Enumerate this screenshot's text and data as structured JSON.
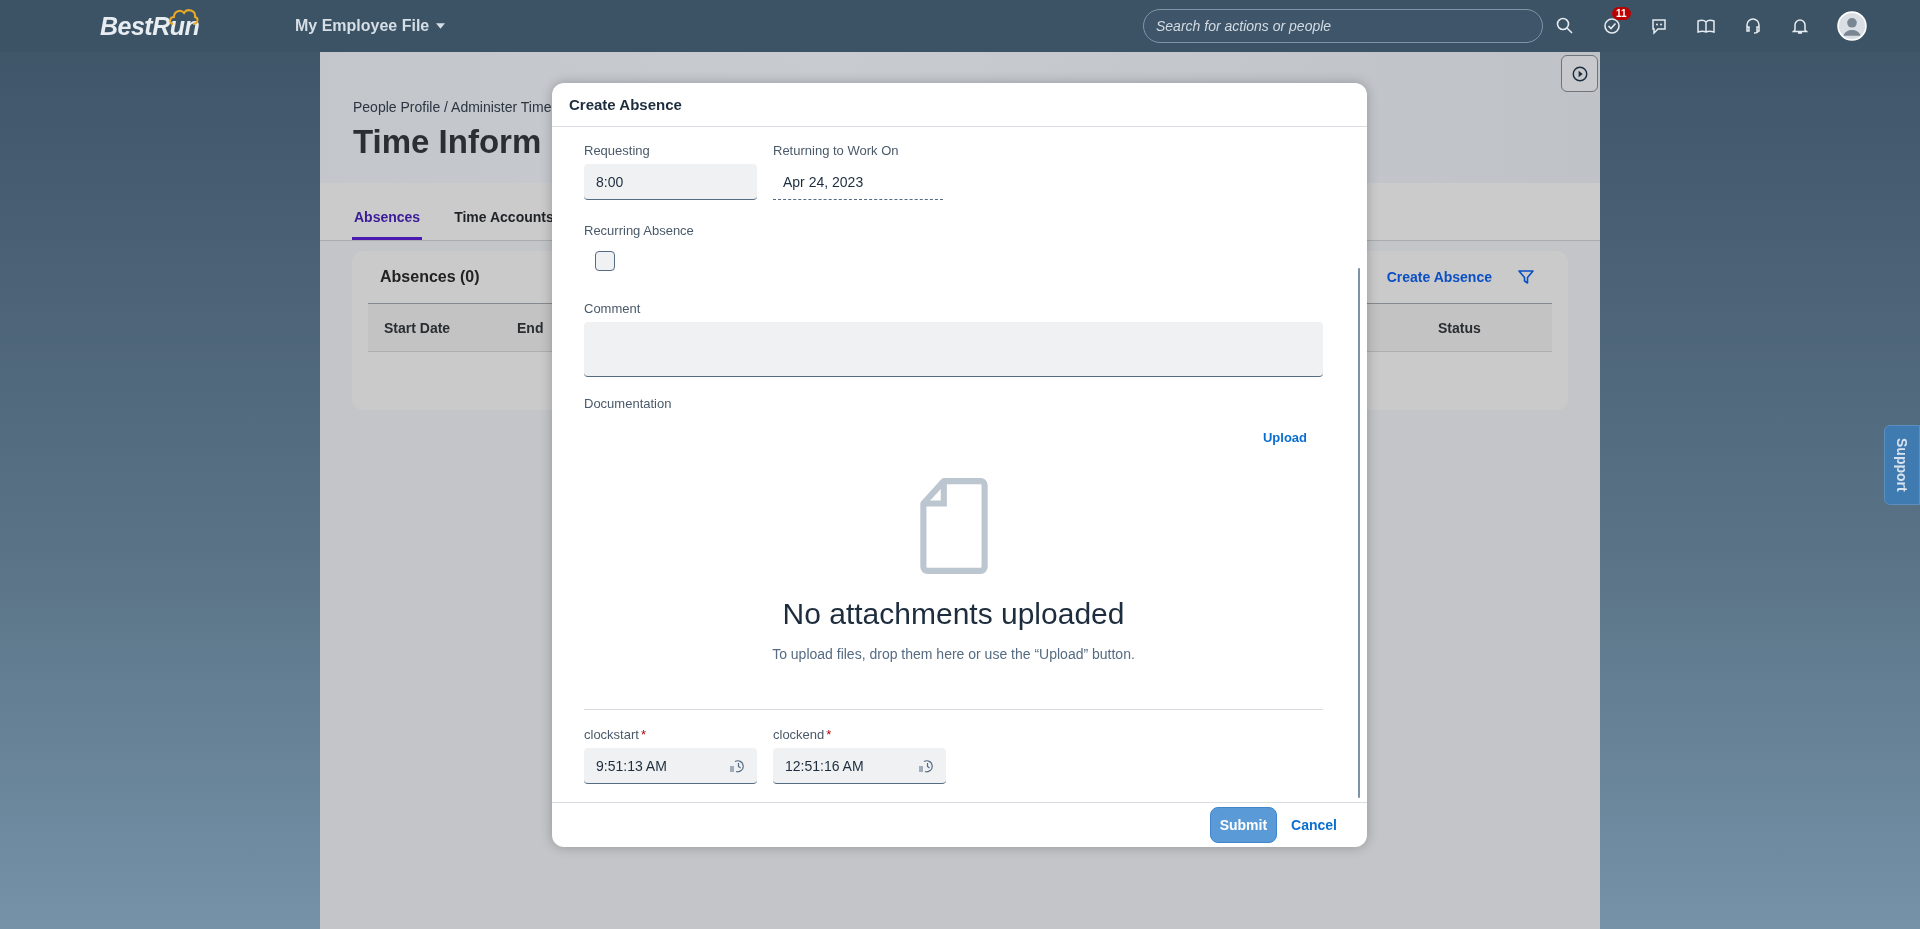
{
  "shell": {
    "logo": "BestRun",
    "app_title": "My Employee File",
    "search": {
      "placeholder": "Search for actions or people"
    },
    "tasks_badge": "11"
  },
  "page": {
    "breadcrumb": "People Profile / Administer Time",
    "title": "Time Inform",
    "tabs": [
      {
        "label": "Absences",
        "selected": true
      },
      {
        "label": "Time Accounts",
        "selected": false
      }
    ],
    "absences": {
      "title": "Absences (0)",
      "action": "Create Absence",
      "columns": [
        "Start Date",
        "End",
        "Status"
      ]
    }
  },
  "dialog": {
    "title": "Create Absence",
    "requesting": {
      "label": "Requesting",
      "value": "8:00"
    },
    "returning": {
      "label": "Returning to Work On",
      "value": "Apr 24, 2023"
    },
    "recurring": {
      "label": "Recurring Absence",
      "checked": false
    },
    "comment": {
      "label": "Comment"
    },
    "documentation": {
      "label": "Documentation",
      "upload": "Upload",
      "empty_title": "No attachments uploaded",
      "empty_hint": "To upload files, drop them here or use the “Upload” button."
    },
    "required_mark": "*",
    "time_fields": [
      {
        "label": "clockstart",
        "required": true,
        "value": "9:51:13 AM"
      },
      {
        "label": "clockend",
        "required": true,
        "value": "12:51:16 AM"
      }
    ],
    "submit": "Submit",
    "cancel": "Cancel"
  },
  "support": "Support"
}
